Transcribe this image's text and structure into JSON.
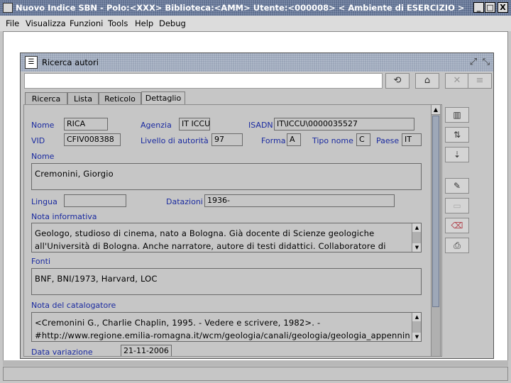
{
  "window": {
    "title": "Nuovo Indice SBN - Polo:<XXX> Biblioteca:<AMM> Utente:<000008>     < Ambiente di ESERCIZIO >",
    "minimize": "_",
    "maximize": "□",
    "close": "X"
  },
  "menu": {
    "items": [
      "File",
      "Visualizza",
      "Funzioni",
      "Tools",
      "Help",
      "Debug"
    ]
  },
  "frame": {
    "title": "Ricerca autori",
    "icon": "document-icon",
    "controls": [
      "restore-icon",
      "minimize-icon"
    ]
  },
  "toolbar": {
    "input_value": "",
    "buttons": [
      "search-icon",
      "home-icon",
      "cancel-icon",
      "list-icon"
    ]
  },
  "tabs": [
    {
      "label": "Ricerca",
      "active": false
    },
    {
      "label": "Lista",
      "active": false
    },
    {
      "label": "Reticolo",
      "active": false
    },
    {
      "label": "Dettaglio",
      "active": true
    }
  ],
  "form": {
    "nome_label": "Nome",
    "nome_value": "RICA",
    "agenzia_label": "Agenzia",
    "agenzia_value": "IT ICCU",
    "isadn_label": "ISADN",
    "isadn_value": "IT\\ICCU\\0000035527",
    "vid_label": "VID",
    "vid_value": "CFIV008388",
    "livello_label": "Livello di autorità",
    "livello_value": "97",
    "forma_label": "Forma",
    "forma_value": "A",
    "tipo_nome_label": "Tipo nome",
    "tipo_nome_value": "C",
    "paese_label": "Paese",
    "paese_value": "IT",
    "nome_section_label": "Nome",
    "nome_full": "Cremonini, Giorgio",
    "lingua_label": "Lingua",
    "lingua_value": "",
    "datazioni_label": "Datazioni",
    "datazioni_value": "1936-",
    "nota_informativa_label": "Nota informativa",
    "nota_informativa_lines": [
      "Geologo, studioso di cinema, nato a Bologna. Già docente di Scienze geologiche",
      "all'Università di Bologna. Anche narratore, autore di testi didattici. Collaboratore di"
    ],
    "fonti_label": "Fonti",
    "fonti_value": "BNF, BNI/1973, Harvard, LOC",
    "nota_catalogatore_label": "Nota del catalogatore",
    "nota_catalogatore_lines": [
      "<Cremonini G., Charlie Chaplin, 1995. - Vedere e scrivere, 1982>. -",
      "#http://www.regione.emilia-romagna.it/wcm/geologia/canali/geologia/geologia_appennin"
    ],
    "data_variazione_label": "Data variazione",
    "data_variazione_value": "21-11-2006"
  },
  "side_buttons": [
    "books-icon",
    "tree-icon",
    "tree-down-icon",
    "edit-doc-icon",
    "disabled-doc-icon",
    "eraser-icon",
    "print-icon"
  ]
}
